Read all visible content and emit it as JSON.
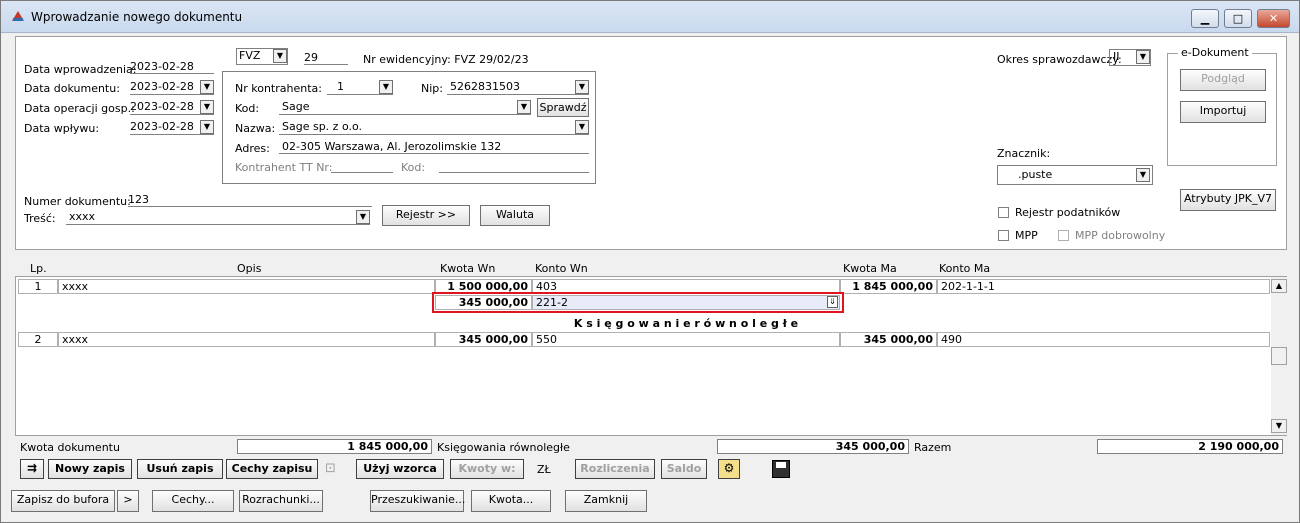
{
  "window": {
    "title": "Wprowadzanie nowego dokumentu",
    "minimize": "▁",
    "maximize": "□",
    "close": "✕"
  },
  "dates": {
    "entry_label": "Data wprowadzenia:",
    "entry_value": "2023-02-28",
    "document_label": "Data dokumentu:",
    "document_value": "2023-02-28",
    "operation_label": "Data operacji gosp.:",
    "operation_value": "2023-02-28",
    "receipt_label": "Data wpływu:",
    "receipt_value": "2023-02-28"
  },
  "doc_type": {
    "value": "FVZ",
    "number": "29",
    "evidence_label": "Nr ewidencyjny: FVZ  29/02/23"
  },
  "contractor": {
    "nr_label": "Nr kontrahenta:",
    "nr_value": "1",
    "nip_label": "Nip:",
    "nip_value": "5262831503",
    "code_label": "Kod:",
    "code_value": "Sage",
    "check_button": "Sprawdź",
    "name_label": "Nazwa:",
    "name_value": "Sage sp. z o.o.",
    "address_label": "Adres:",
    "address_value": "02-305 Warszawa, Al. Jerozolimskie 132",
    "tt_label": "Kontrahent TT Nr:",
    "tt_code_label": "Kod:"
  },
  "document_number": {
    "label": "Numer dokumentu:",
    "value": "123"
  },
  "content": {
    "label": "Treść:",
    "value": "xxxx"
  },
  "buttons_mid": {
    "register": "Rejestr >>",
    "currency": "Waluta"
  },
  "period": {
    "label": "Okres sprawozdawczy:",
    "value": "II"
  },
  "edocument": {
    "title": "e-Dokument",
    "preview": "Podgląd",
    "import": "Importuj"
  },
  "marker": {
    "label": "Znacznik:",
    "value": ".puste"
  },
  "jpk_button": "Atrybuty JPK_V7",
  "checkboxes": {
    "tax_register": "Rejestr podatników",
    "mpp": "MPP",
    "mpp_voluntary": "MPP dobrowolny"
  },
  "table": {
    "headers": {
      "lp": "Lp.",
      "desc": "Opis",
      "amount_wn": "Kwota  Wn",
      "account_wn": "Konto  Wn",
      "amount_ma": "Kwota Ma",
      "account_ma": "Konto Ma"
    },
    "rows": [
      {
        "lp": "1",
        "desc": "xxxx",
        "amount_wn": "1 500 000,00",
        "account_wn": "403",
        "amount_ma": "1 845 000,00",
        "account_ma": "202-1-1-1"
      },
      {
        "amount_wn": "345 000,00",
        "account_wn": "221-2"
      },
      {
        "lp": "2",
        "desc": "xxxx",
        "amount_wn": "345 000,00",
        "account_wn": "550",
        "amount_ma": "345 000,00",
        "account_ma": "490"
      }
    ],
    "parallel_label": "K s i ę g o w a n i e   r ó w n o l e g ł e"
  },
  "summary": {
    "doc_amount_label": "Kwota dokumentu",
    "doc_amount_value": "1 845 000,00",
    "parallel_label": "Księgowania równoległe",
    "parallel_value": "345 000,00",
    "total_label": "Razem",
    "total_value": "2 190 000,00"
  },
  "toolbar": {
    "new_entry": "Nowy zapis",
    "delete_entry": "Usuń zapis",
    "features": "Cechy zapisu",
    "use_template": "Użyj wzorca",
    "amounts": "Kwoty w:",
    "currency": "ZŁ",
    "settlements": "Rozliczenia",
    "balance": "Saldo"
  },
  "bottom": {
    "save_buffer": "Zapisz do bufora",
    "arrow": ">",
    "features": "Cechy...",
    "settlements": "Rozrachunki...",
    "search": "Przeszukiwanie...",
    "amount": "Kwota...",
    "close": "Zamknij"
  }
}
